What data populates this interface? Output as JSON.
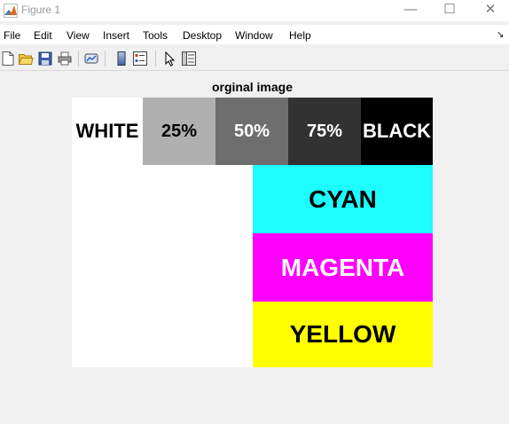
{
  "window": {
    "title": "Figure 1",
    "icon": "matlab-icon",
    "controls": [
      "minimize-icon",
      "maximize-icon",
      "close-icon"
    ]
  },
  "menu": {
    "items": [
      "File",
      "Edit",
      "View",
      "Insert",
      "Tools",
      "Desktop",
      "Window",
      "Help"
    ],
    "overflow_glyph": "↘"
  },
  "toolbar": {
    "icons": [
      "new-figure-icon",
      "open-file-icon",
      "save-icon",
      "print-icon",
      "link-plot-icon",
      "insert-colorbar-icon",
      "insert-legend-icon",
      "edit-plot-icon",
      "property-inspector-icon"
    ]
  },
  "figure": {
    "title": "orginal image",
    "swatches": {
      "white": {
        "label": "WHITE",
        "color": "#ffffff"
      },
      "gray25": {
        "label": "25%",
        "color": "#b0b0b0"
      },
      "gray50": {
        "label": "50%",
        "color": "#6e6e6e"
      },
      "gray75": {
        "label": "75%",
        "color": "#323232"
      },
      "black": {
        "label": "BLACK",
        "color": "#000000"
      },
      "cyan": {
        "label": "CYAN",
        "color": "#1bfdfe"
      },
      "magenta": {
        "label": "MAGENTA",
        "color": "#fd01fd"
      },
      "yellow": {
        "label": "YELLOW",
        "color": "#fefe00"
      }
    }
  }
}
